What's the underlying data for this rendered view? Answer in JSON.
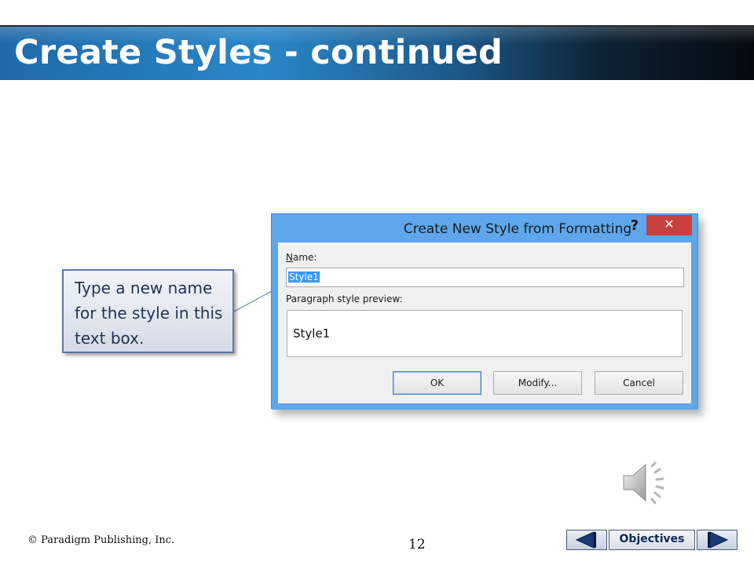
{
  "slide": {
    "title": "Create Styles - continued",
    "callout_text": "Type a new name for the style in this text box.",
    "copyright": "© Paradigm Publishing, Inc.",
    "page_number": "12"
  },
  "dialog": {
    "title": "Create New Style from Formatting",
    "help_label": "?",
    "close_label": "✕",
    "name_label": "Name:",
    "name_value": "Style1",
    "preview_label": "Paragraph style preview:",
    "preview_text": "Style1",
    "buttons": {
      "ok": "OK",
      "modify": "Modify...",
      "cancel": "Cancel"
    }
  },
  "navigation": {
    "objectives_label": "Objectives"
  },
  "colors": {
    "title_blue": "#2a86c8",
    "dialog_frame": "#5ea7ec",
    "close_red": "#c9413c",
    "selection": "#3399ff",
    "callout_border": "#5a79a8"
  },
  "icons": [
    "speaker-icon",
    "arrow-left-icon",
    "arrow-right-icon",
    "close-icon",
    "help-icon"
  ]
}
